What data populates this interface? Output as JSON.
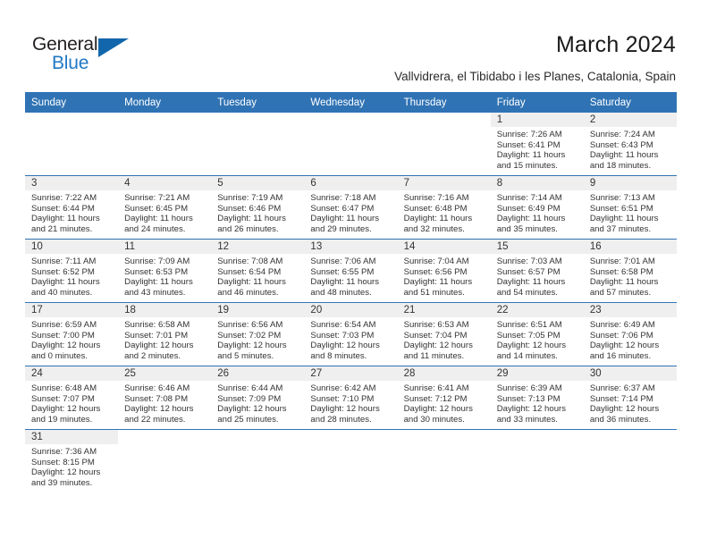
{
  "brand": {
    "name_top": "General",
    "name_bottom": "Blue",
    "accent_color": "#2079c4",
    "mark_color": "#1266ab"
  },
  "header": {
    "title": "March 2024",
    "subtitle": "Vallvidrera, el Tibidabo i les Planes, Catalonia, Spain"
  },
  "theme": {
    "header_blue": "#3073b4",
    "daynum_band": "#efefef",
    "text": "#333333"
  },
  "weekday_headers": [
    "Sunday",
    "Monday",
    "Tuesday",
    "Wednesday",
    "Thursday",
    "Friday",
    "Saturday"
  ],
  "weeks": [
    [
      {
        "blank": true
      },
      {
        "blank": true
      },
      {
        "blank": true
      },
      {
        "blank": true
      },
      {
        "blank": true
      },
      {
        "day": "1",
        "sunrise": "Sunrise: 7:26 AM",
        "sunset": "Sunset: 6:41 PM",
        "daylight_line1": "Daylight: 11 hours",
        "daylight_line2": "and 15 minutes."
      },
      {
        "day": "2",
        "sunrise": "Sunrise: 7:24 AM",
        "sunset": "Sunset: 6:43 PM",
        "daylight_line1": "Daylight: 11 hours",
        "daylight_line2": "and 18 minutes."
      }
    ],
    [
      {
        "day": "3",
        "sunrise": "Sunrise: 7:22 AM",
        "sunset": "Sunset: 6:44 PM",
        "daylight_line1": "Daylight: 11 hours",
        "daylight_line2": "and 21 minutes."
      },
      {
        "day": "4",
        "sunrise": "Sunrise: 7:21 AM",
        "sunset": "Sunset: 6:45 PM",
        "daylight_line1": "Daylight: 11 hours",
        "daylight_line2": "and 24 minutes."
      },
      {
        "day": "5",
        "sunrise": "Sunrise: 7:19 AM",
        "sunset": "Sunset: 6:46 PM",
        "daylight_line1": "Daylight: 11 hours",
        "daylight_line2": "and 26 minutes."
      },
      {
        "day": "6",
        "sunrise": "Sunrise: 7:18 AM",
        "sunset": "Sunset: 6:47 PM",
        "daylight_line1": "Daylight: 11 hours",
        "daylight_line2": "and 29 minutes."
      },
      {
        "day": "7",
        "sunrise": "Sunrise: 7:16 AM",
        "sunset": "Sunset: 6:48 PM",
        "daylight_line1": "Daylight: 11 hours",
        "daylight_line2": "and 32 minutes."
      },
      {
        "day": "8",
        "sunrise": "Sunrise: 7:14 AM",
        "sunset": "Sunset: 6:49 PM",
        "daylight_line1": "Daylight: 11 hours",
        "daylight_line2": "and 35 minutes."
      },
      {
        "day": "9",
        "sunrise": "Sunrise: 7:13 AM",
        "sunset": "Sunset: 6:51 PM",
        "daylight_line1": "Daylight: 11 hours",
        "daylight_line2": "and 37 minutes."
      }
    ],
    [
      {
        "day": "10",
        "sunrise": "Sunrise: 7:11 AM",
        "sunset": "Sunset: 6:52 PM",
        "daylight_line1": "Daylight: 11 hours",
        "daylight_line2": "and 40 minutes."
      },
      {
        "day": "11",
        "sunrise": "Sunrise: 7:09 AM",
        "sunset": "Sunset: 6:53 PM",
        "daylight_line1": "Daylight: 11 hours",
        "daylight_line2": "and 43 minutes."
      },
      {
        "day": "12",
        "sunrise": "Sunrise: 7:08 AM",
        "sunset": "Sunset: 6:54 PM",
        "daylight_line1": "Daylight: 11 hours",
        "daylight_line2": "and 46 minutes."
      },
      {
        "day": "13",
        "sunrise": "Sunrise: 7:06 AM",
        "sunset": "Sunset: 6:55 PM",
        "daylight_line1": "Daylight: 11 hours",
        "daylight_line2": "and 48 minutes."
      },
      {
        "day": "14",
        "sunrise": "Sunrise: 7:04 AM",
        "sunset": "Sunset: 6:56 PM",
        "daylight_line1": "Daylight: 11 hours",
        "daylight_line2": "and 51 minutes."
      },
      {
        "day": "15",
        "sunrise": "Sunrise: 7:03 AM",
        "sunset": "Sunset: 6:57 PM",
        "daylight_line1": "Daylight: 11 hours",
        "daylight_line2": "and 54 minutes."
      },
      {
        "day": "16",
        "sunrise": "Sunrise: 7:01 AM",
        "sunset": "Sunset: 6:58 PM",
        "daylight_line1": "Daylight: 11 hours",
        "daylight_line2": "and 57 minutes."
      }
    ],
    [
      {
        "day": "17",
        "sunrise": "Sunrise: 6:59 AM",
        "sunset": "Sunset: 7:00 PM",
        "daylight_line1": "Daylight: 12 hours",
        "daylight_line2": "and 0 minutes."
      },
      {
        "day": "18",
        "sunrise": "Sunrise: 6:58 AM",
        "sunset": "Sunset: 7:01 PM",
        "daylight_line1": "Daylight: 12 hours",
        "daylight_line2": "and 2 minutes."
      },
      {
        "day": "19",
        "sunrise": "Sunrise: 6:56 AM",
        "sunset": "Sunset: 7:02 PM",
        "daylight_line1": "Daylight: 12 hours",
        "daylight_line2": "and 5 minutes."
      },
      {
        "day": "20",
        "sunrise": "Sunrise: 6:54 AM",
        "sunset": "Sunset: 7:03 PM",
        "daylight_line1": "Daylight: 12 hours",
        "daylight_line2": "and 8 minutes."
      },
      {
        "day": "21",
        "sunrise": "Sunrise: 6:53 AM",
        "sunset": "Sunset: 7:04 PM",
        "daylight_line1": "Daylight: 12 hours",
        "daylight_line2": "and 11 minutes."
      },
      {
        "day": "22",
        "sunrise": "Sunrise: 6:51 AM",
        "sunset": "Sunset: 7:05 PM",
        "daylight_line1": "Daylight: 12 hours",
        "daylight_line2": "and 14 minutes."
      },
      {
        "day": "23",
        "sunrise": "Sunrise: 6:49 AM",
        "sunset": "Sunset: 7:06 PM",
        "daylight_line1": "Daylight: 12 hours",
        "daylight_line2": "and 16 minutes."
      }
    ],
    [
      {
        "day": "24",
        "sunrise": "Sunrise: 6:48 AM",
        "sunset": "Sunset: 7:07 PM",
        "daylight_line1": "Daylight: 12 hours",
        "daylight_line2": "and 19 minutes."
      },
      {
        "day": "25",
        "sunrise": "Sunrise: 6:46 AM",
        "sunset": "Sunset: 7:08 PM",
        "daylight_line1": "Daylight: 12 hours",
        "daylight_line2": "and 22 minutes."
      },
      {
        "day": "26",
        "sunrise": "Sunrise: 6:44 AM",
        "sunset": "Sunset: 7:09 PM",
        "daylight_line1": "Daylight: 12 hours",
        "daylight_line2": "and 25 minutes."
      },
      {
        "day": "27",
        "sunrise": "Sunrise: 6:42 AM",
        "sunset": "Sunset: 7:10 PM",
        "daylight_line1": "Daylight: 12 hours",
        "daylight_line2": "and 28 minutes."
      },
      {
        "day": "28",
        "sunrise": "Sunrise: 6:41 AM",
        "sunset": "Sunset: 7:12 PM",
        "daylight_line1": "Daylight: 12 hours",
        "daylight_line2": "and 30 minutes."
      },
      {
        "day": "29",
        "sunrise": "Sunrise: 6:39 AM",
        "sunset": "Sunset: 7:13 PM",
        "daylight_line1": "Daylight: 12 hours",
        "daylight_line2": "and 33 minutes."
      },
      {
        "day": "30",
        "sunrise": "Sunrise: 6:37 AM",
        "sunset": "Sunset: 7:14 PM",
        "daylight_line1": "Daylight: 12 hours",
        "daylight_line2": "and 36 minutes."
      }
    ],
    [
      {
        "day": "31",
        "sunrise": "Sunrise: 7:36 AM",
        "sunset": "Sunset: 8:15 PM",
        "daylight_line1": "Daylight: 12 hours",
        "daylight_line2": "and 39 minutes."
      },
      {
        "blank": true
      },
      {
        "blank": true
      },
      {
        "blank": true
      },
      {
        "blank": true
      },
      {
        "blank": true
      },
      {
        "blank": true
      }
    ]
  ]
}
